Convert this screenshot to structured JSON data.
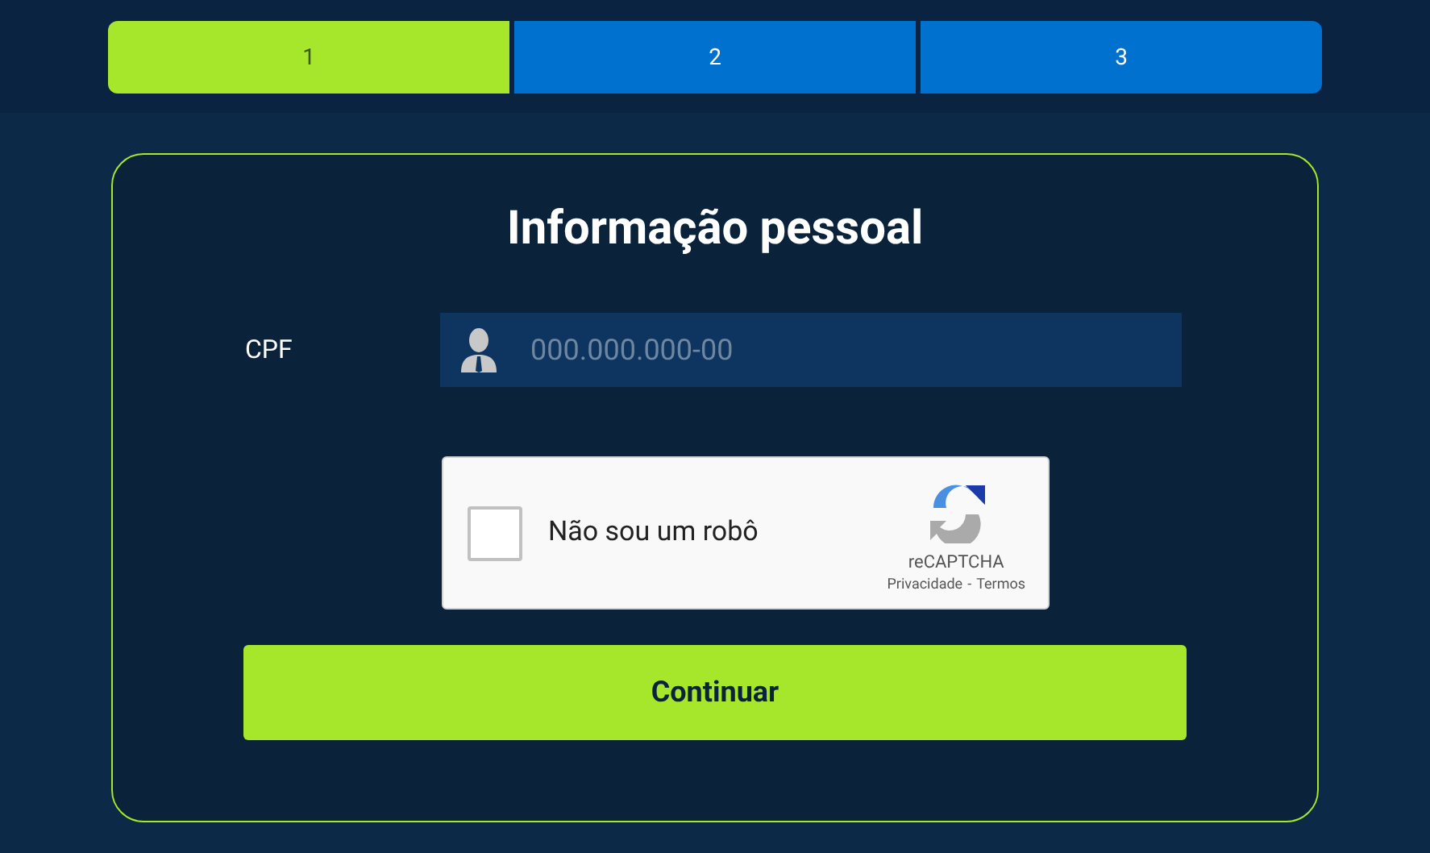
{
  "steps": [
    {
      "label": "1",
      "selected": true
    },
    {
      "label": "2",
      "selected": false
    },
    {
      "label": "3",
      "selected": false
    }
  ],
  "form": {
    "title": "Informação pessoal",
    "fields": [
      {
        "label": "CPF",
        "placeholder": "000.000.000-00"
      }
    ],
    "captcha": {
      "label": "Não sou um robô",
      "checked": false,
      "brand": "reCAPTCHA",
      "links": [
        "Privacidade",
        "Termos"
      ],
      "separator": "-"
    },
    "submit": "Continuar"
  }
}
